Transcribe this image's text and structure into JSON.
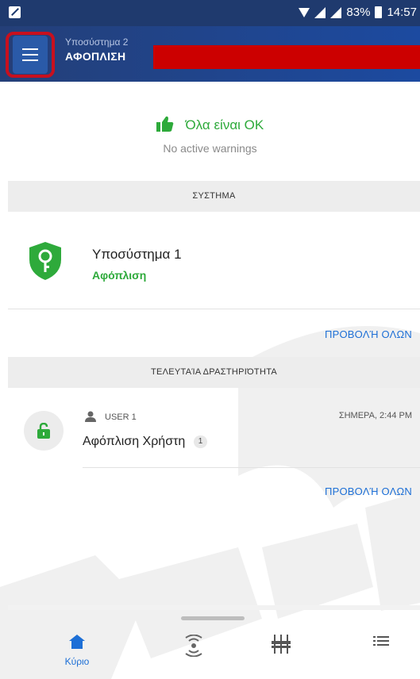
{
  "status_bar": {
    "battery": "83%",
    "time": "14:57"
  },
  "header": {
    "subtitle": "Υποσύστημα 2",
    "title": "ΑΦΟΠΛΙΣΗ"
  },
  "summary": {
    "ok_text": "Όλα είναι OK",
    "warnings_text": "No active warnings"
  },
  "system_section": {
    "header": "ΣΥΣΤΗΜΑ",
    "partition_name": "Υποσύστημα 1",
    "partition_status": "Αφόπλιση",
    "view_all": "ΠΡΟΒΟΛΉ ΟΛΩΝ"
  },
  "activity_section": {
    "header": "ΤΕΛΕΥΤΑΊΑ ΔΡΑΣΤΗΡΙΌΤΗΤΑ",
    "user": "USER 1",
    "time": "ΣΗΜΕΡΑ, 2:44 PM",
    "description": "Αφόπλιση Χρήστη",
    "badge": "1",
    "view_all": "ΠΡΟΒΟΛΉ ΟΛΩΝ"
  },
  "bottom_nav": {
    "home_label": "Κύριο",
    "icons": [
      "home-icon",
      "sensors-icon",
      "controls-icon",
      "list-icon"
    ]
  },
  "colors": {
    "header": "#243f78",
    "accent_green": "#2eaa3b",
    "link_blue": "#1d6fd6",
    "highlight_red": "#c8101e"
  }
}
